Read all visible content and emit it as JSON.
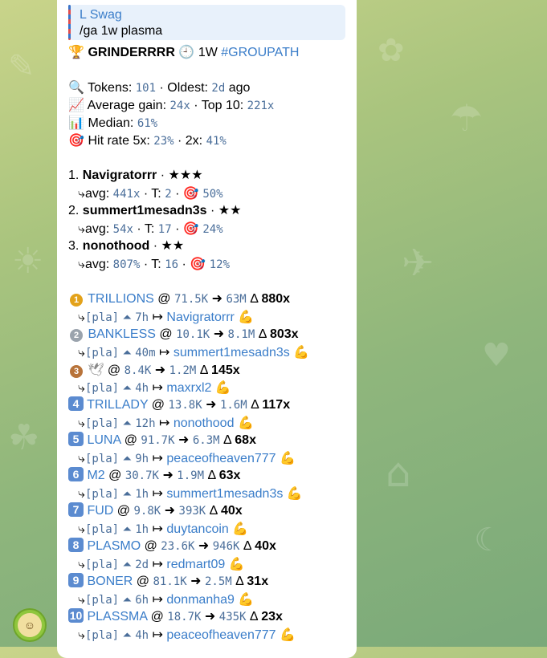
{
  "reply": {
    "author": "L Swag",
    "text": "/ga 1w plasma"
  },
  "header": {
    "name": "GRINDERRRR",
    "period": "1W",
    "tag": "#GROUPATH"
  },
  "stats": {
    "tokens_label": "Tokens:",
    "tokens": "101",
    "oldest_label": "Oldest:",
    "oldest": "2d",
    "oldest_suffix": "ago",
    "avg_label": "Average gain:",
    "avg": "24x",
    "top10_label": "Top 10:",
    "top10": "221x",
    "median_label": "Median:",
    "median": "61%",
    "hit_label": "Hit rate 5x:",
    "hit5": "23%",
    "hit2_label": "2x:",
    "hit2": "41%"
  },
  "leaders": [
    {
      "rank": "1.",
      "name": "Navigratorrr",
      "stars": "★★★",
      "avg": "441x",
      "t": "2",
      "rate": "50%"
    },
    {
      "rank": "2.",
      "name": "summert1mesadn3s",
      "stars": "★★",
      "avg": "54x",
      "t": "17",
      "rate": "24%"
    },
    {
      "rank": "3.",
      "name": "nonothood",
      "stars": "★★",
      "avg": "807%",
      "t": "16",
      "rate": "12%"
    }
  ],
  "calls": [
    {
      "badge": "1",
      "name": "TRILLIONS",
      "from": "71.5K",
      "to": "63M",
      "gain": "880x",
      "tag": "[pla]",
      "time": "7h",
      "user": "Navigratorrr"
    },
    {
      "badge": "2",
      "name": "BANKLESS",
      "from": "10.1K",
      "to": "8.1M",
      "gain": "803x",
      "tag": "[pla]",
      "time": "40m",
      "user": "summert1mesadn3s"
    },
    {
      "badge": "3",
      "name": "",
      "from": "8.4K",
      "to": "1.2M",
      "gain": "145x",
      "tag": "[pla]",
      "time": "4h",
      "user": "maxrxl2"
    },
    {
      "badge": "4",
      "name": "TRILLADY",
      "from": "13.8K",
      "to": "1.6M",
      "gain": "117x",
      "tag": "[pla]",
      "time": "12h",
      "user": "nonothood"
    },
    {
      "badge": "5",
      "name": "LUNA",
      "from": "91.7K",
      "to": "6.3M",
      "gain": "68x",
      "tag": "[pla]",
      "time": "9h",
      "user": "peaceofheaven777"
    },
    {
      "badge": "6",
      "name": "M2",
      "from": "30.7K",
      "to": "1.9M",
      "gain": "63x",
      "tag": "[pla]",
      "time": "1h",
      "user": "summert1mesadn3s"
    },
    {
      "badge": "7",
      "name": "FUD",
      "from": "9.8K",
      "to": "393K",
      "gain": "40x",
      "tag": "[pla]",
      "time": "1h",
      "user": "duytancoin"
    },
    {
      "badge": "8",
      "name": "PLASMO",
      "from": "23.6K",
      "to": "946K",
      "gain": "40x",
      "tag": "[pla]",
      "time": "2d",
      "user": "redmart09"
    },
    {
      "badge": "9",
      "name": "BONER",
      "from": "81.1K",
      "to": "2.5M",
      "gain": "31x",
      "tag": "[pla]",
      "time": "6h",
      "user": "donmanha9"
    },
    {
      "badge": "10",
      "name": "PLASSMA",
      "from": "18.7K",
      "to": "435K",
      "gain": "23x",
      "tag": "[pla]",
      "time": "4h",
      "user": "peaceofheaven777"
    }
  ],
  "colors": {
    "link": "#3a7dc9",
    "mono": "#4a6e9a",
    "gold": "#e3a21a",
    "silver": "#9aa3ad",
    "bronze": "#b8733a",
    "badge": "#5b8bd0"
  }
}
